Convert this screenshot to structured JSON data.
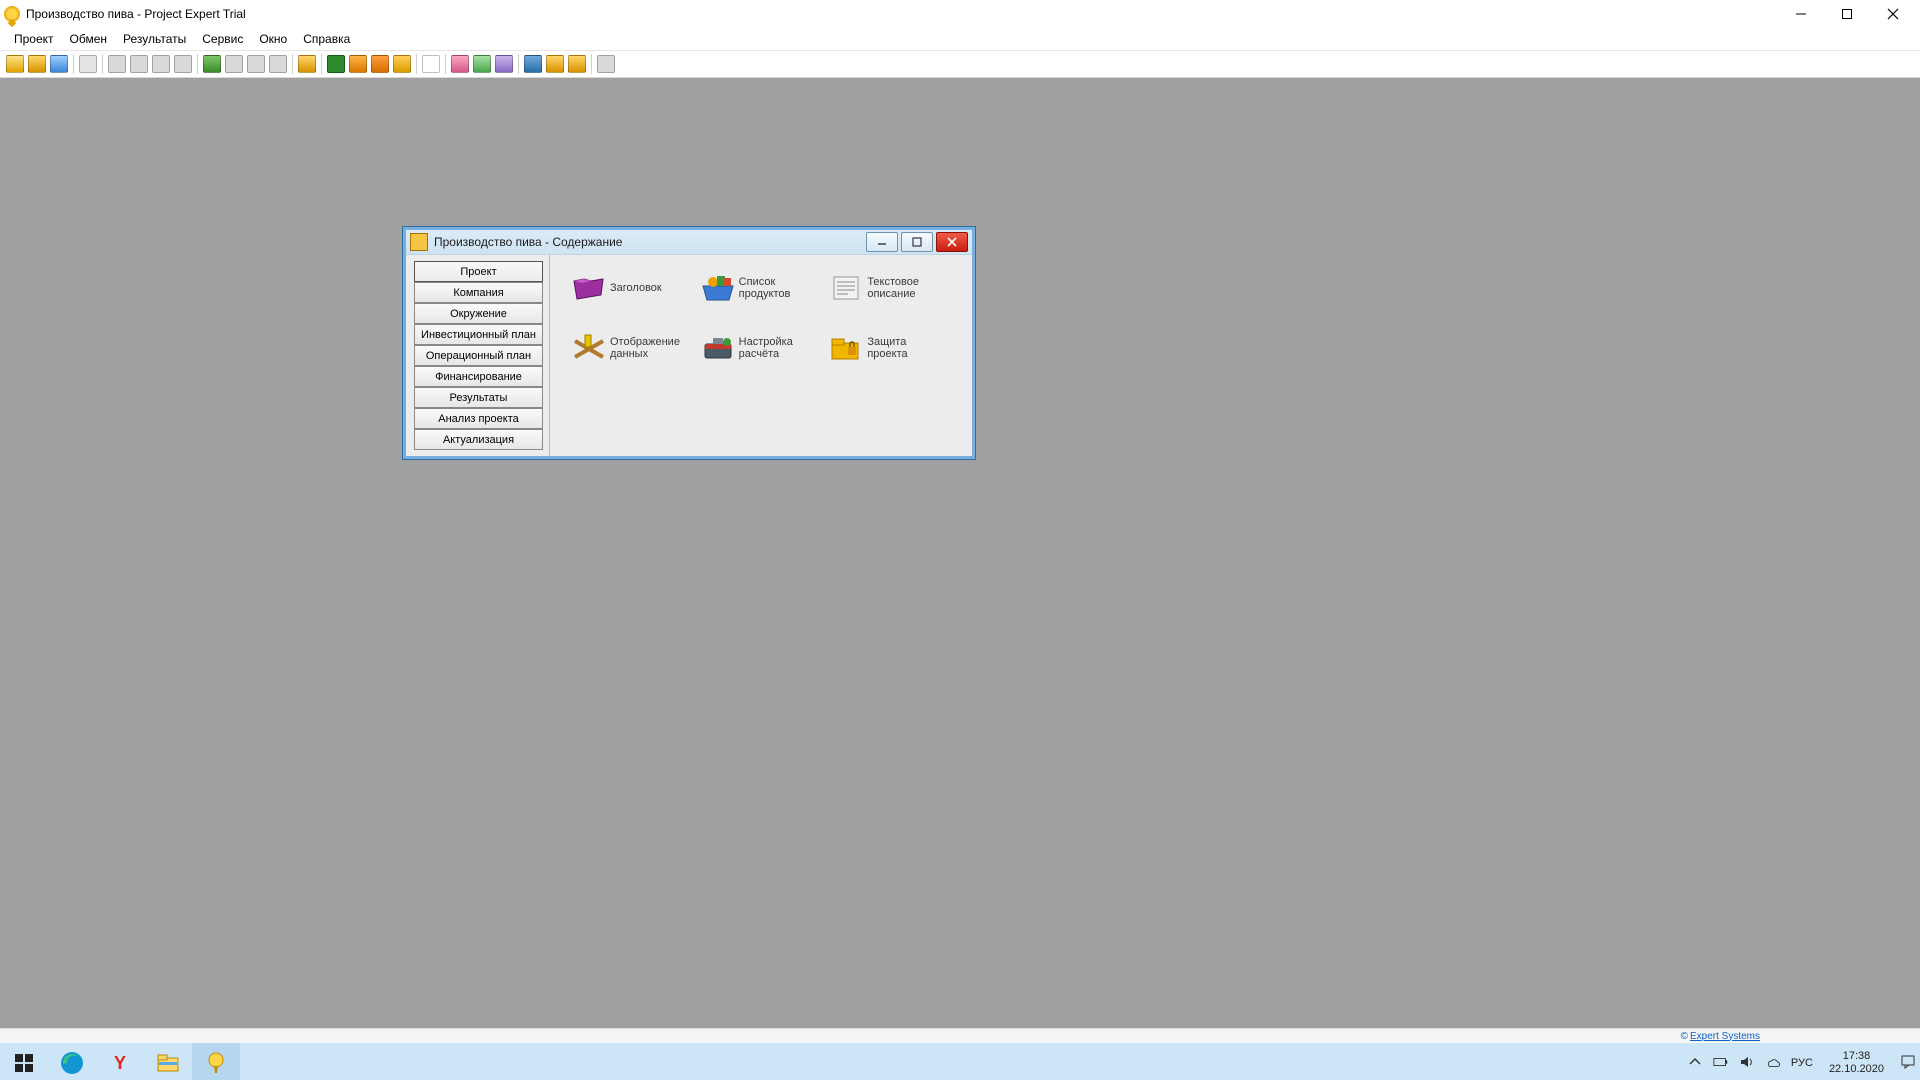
{
  "window": {
    "title": "Производство пива - Project Expert Trial"
  },
  "menu": {
    "items": [
      "Проект",
      "Обмен",
      "Результаты",
      "Сервис",
      "Окно",
      "Справка"
    ]
  },
  "toolbar": {
    "groups": [
      [
        "new-project",
        "open-project",
        "save-project"
      ],
      [
        "schema"
      ],
      [
        "print",
        "print-a",
        "print-b",
        "print-c"
      ],
      [
        "chart-a",
        "chart-b",
        "chart-c",
        "chart-d"
      ],
      [
        "calc"
      ],
      [
        "pl-report",
        "cf-report",
        "bal-report",
        "ratio-report"
      ],
      [
        "find"
      ],
      [
        "user-a",
        "user-b",
        "user-c"
      ],
      [
        "flag-a",
        "flag-b",
        "flag-c"
      ],
      [
        "extra"
      ]
    ]
  },
  "dialog": {
    "title": "Производство пива - Содержание",
    "nav": [
      "Проект",
      "Компания",
      "Окружение",
      "Инвестиционный план",
      "Операционный план",
      "Финансирование",
      "Результаты",
      "Анализ проекта",
      "Актуализация"
    ],
    "nav_active": 0,
    "tiles": [
      {
        "id": "title",
        "label": "Заголовок"
      },
      {
        "id": "products",
        "label": "Список\nпродуктов"
      },
      {
        "id": "textdesc",
        "label": "Текстовое\nописание"
      },
      {
        "id": "display",
        "label": "Отображение\nданных"
      },
      {
        "id": "calcset",
        "label": "Настройка\nрасчёта"
      },
      {
        "id": "protect",
        "label": "Защита\nпроекта"
      }
    ]
  },
  "status": {
    "link_label": "Expert Systems"
  },
  "tray": {
    "lang": "РУС",
    "time": "17:38",
    "date": "22.10.2020"
  }
}
